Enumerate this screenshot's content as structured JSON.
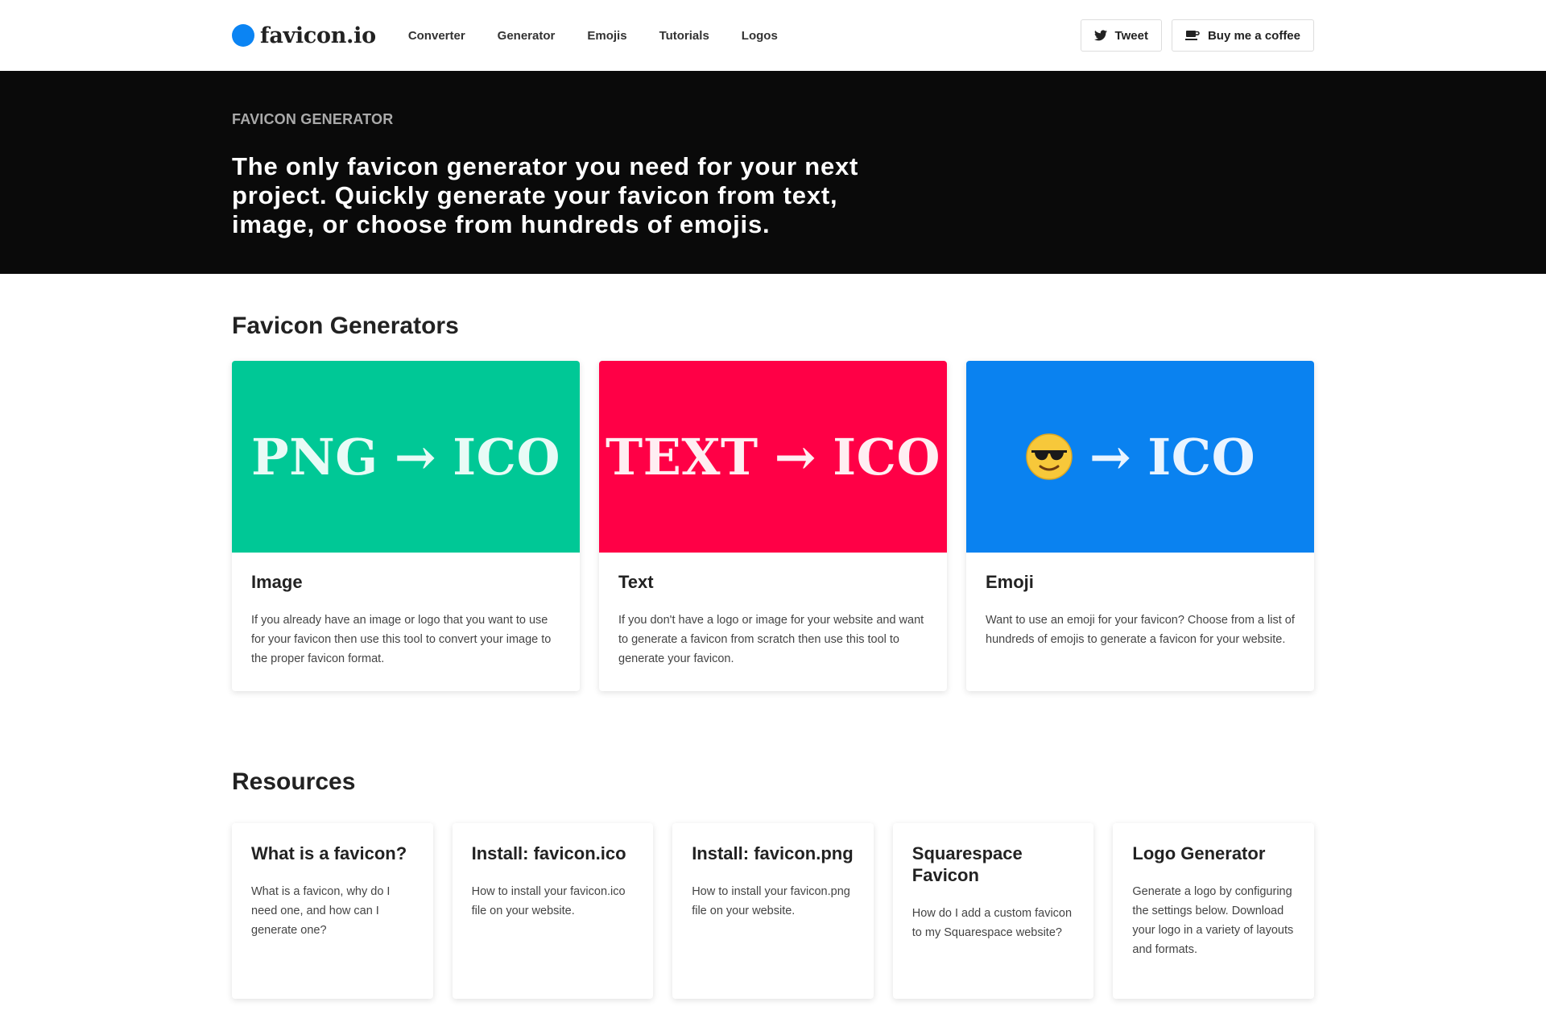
{
  "nav": {
    "logo": "favicon.io",
    "links": [
      "Converter",
      "Generator",
      "Emojis",
      "Tutorials",
      "Logos"
    ],
    "tweet_label": "Tweet",
    "coffee_label": "Buy me a coffee"
  },
  "hero": {
    "kicker": "FAVICON GENERATOR",
    "title": "The only favicon generator you need for your next project. Quickly generate your favicon from text, image, or choose from hundreds of emojis."
  },
  "generators": {
    "title": "Favicon Generators",
    "cards": [
      {
        "banner_left": "PNG",
        "arrow": "→",
        "banner_right": "ICO",
        "color": "#00c896",
        "name": "Image",
        "desc": "If you already have an image or logo that you want to use for your favicon then use this tool to convert your image to the proper favicon format."
      },
      {
        "banner_left": "TEXT",
        "arrow": "→",
        "banner_right": "ICO",
        "color": "#ff0046",
        "name": "Text",
        "desc": "If you don't have a logo or image for your website and want to generate a favicon from scratch then use this tool to generate your favicon."
      },
      {
        "banner_left": "",
        "icon": "sunglasses-emoji",
        "arrow": "→",
        "banner_right": "ICO",
        "color": "#0a82f0",
        "name": "Emoji",
        "desc": "Want to use an emoji for your favicon? Choose from a list of hundreds of emojis to generate a favicon for your website."
      }
    ]
  },
  "resources": {
    "title": "Resources",
    "cards": [
      {
        "name": "What is a favicon?",
        "desc": "What is a favicon, why do I need one, and how can I generate one?"
      },
      {
        "name": "Install: favicon.ico",
        "desc": "How to install your favicon.ico file on your website."
      },
      {
        "name": "Install: favicon.png",
        "desc": "How to install your favicon.png file on your website."
      },
      {
        "name": "Squarespace Favicon",
        "desc": "How do I add a custom favicon to my Squarespace website?"
      },
      {
        "name": "Logo Generator",
        "desc": "Generate a logo by configuring the settings below. Download your logo in a variety of layouts and formats."
      }
    ]
  }
}
